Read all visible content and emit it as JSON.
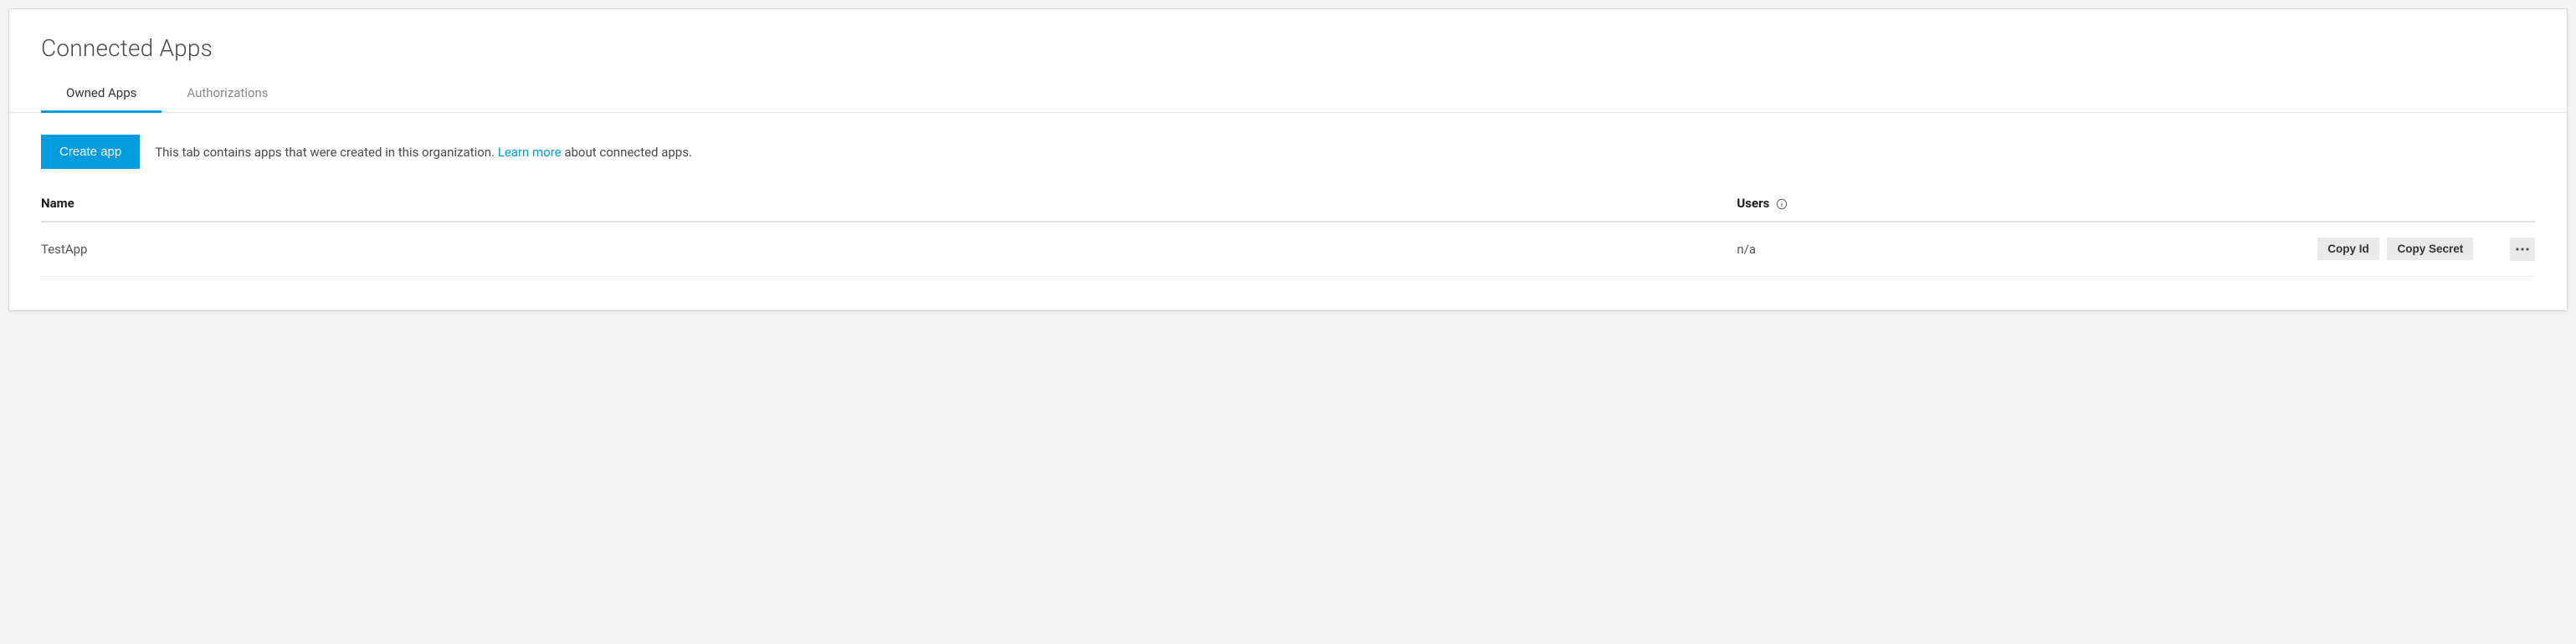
{
  "header": {
    "title": "Connected Apps"
  },
  "tabs": {
    "owned": "Owned Apps",
    "authorizations": "Authorizations"
  },
  "toolbar": {
    "create_app_label": "Create app",
    "description_before": "This tab contains apps that were created in this organization. ",
    "learn_more": "Learn more",
    "description_after": " about connected apps."
  },
  "table": {
    "headers": {
      "name": "Name",
      "users": "Users"
    },
    "rows": [
      {
        "name": "TestApp",
        "users": "n/a",
        "copy_id_label": "Copy Id",
        "copy_secret_label": "Copy Secret"
      }
    ]
  },
  "icons": {
    "info": "info-circle-icon",
    "more": "more-horizontal-icon"
  }
}
